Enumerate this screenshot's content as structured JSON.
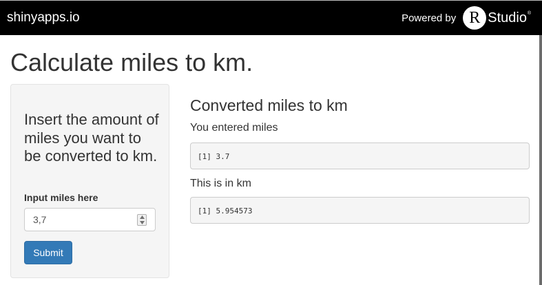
{
  "topbar": {
    "brand": "shinyapps.io",
    "powered_by": "Powered by",
    "logo_letter": "R",
    "logo_text": "Studio",
    "logo_mark": "®"
  },
  "page": {
    "title": "Calculate miles to km."
  },
  "sidebar": {
    "heading": "Insert the amount of miles you want to be converted to km.",
    "input_label": "Input miles here",
    "input_value": "3,7",
    "submit_label": "Submit"
  },
  "main": {
    "heading": "Converted miles to km",
    "entered_label": "You entered miles",
    "entered_output": "[1] 3.7",
    "km_label": "This is in km",
    "km_output": "[1] 5.954573"
  },
  "colors": {
    "topbar_bg": "#000000",
    "button_primary": "#337ab7",
    "well_bg": "#f5f5f5"
  },
  "icons": {
    "spinner_up": "triangle-up-icon",
    "spinner_down": "triangle-down-icon"
  }
}
